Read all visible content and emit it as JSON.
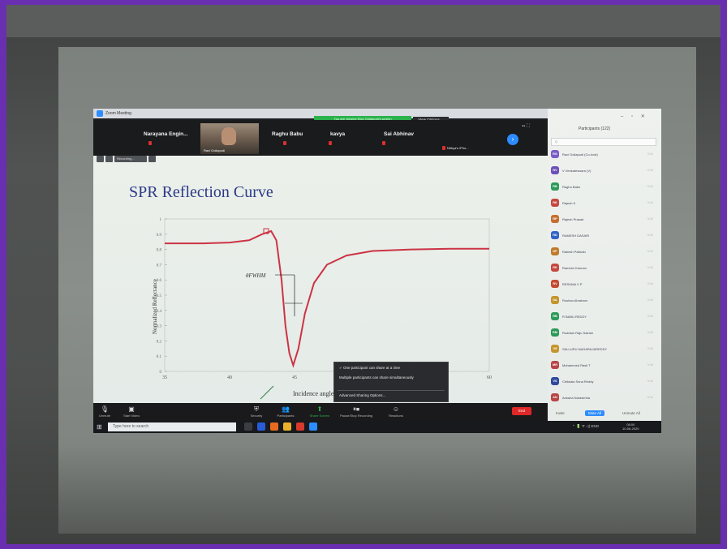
{
  "zoom": {
    "window_title": "Zoom Meeting",
    "share_banner": "You are viewing Ravi Gollapudi's screen",
    "view_options_label": "View Options ⌄"
  },
  "video_tiles": [
    {
      "name": "Narayana Engin...",
      "caption": ""
    },
    {
      "name": "",
      "caption": "Ravi Gollapudi"
    },
    {
      "name": "Raghu Babu",
      "caption": ""
    },
    {
      "name": "kavya",
      "caption": ""
    },
    {
      "name": "Sai Abhinav",
      "caption": ""
    },
    {
      "name": "",
      "caption": "Nithya's iPho..."
    }
  ],
  "slide": {
    "toolbar_label": "Recording...",
    "title": "SPR Reflection Curve"
  },
  "chart_data": {
    "type": "line",
    "title": "SPR Reflection Curve",
    "xlabel": "Incidence angle",
    "ylabel": "Normalized Reflectance",
    "xlim": [
      35,
      60
    ],
    "ylim": [
      0,
      1
    ],
    "x_ticks": [
      "35",
      "40",
      "45",
      "60"
    ],
    "y_ticks": [
      "0",
      "0.1",
      "0.2",
      "0.3",
      "0.4",
      "0.5",
      "0.6",
      "0.7",
      "0.8",
      "0.9",
      "1"
    ],
    "annotation": "θFWHM",
    "grid": false,
    "series": [
      {
        "color": "#cc3344",
        "x": [
          35,
          38,
          40,
          41.5,
          42.5,
          43.2,
          43.6,
          44,
          44.3,
          44.6,
          44.9,
          45.3,
          45.8,
          46.5,
          47.5,
          49,
          51,
          54,
          57,
          60
        ],
        "y": [
          0.84,
          0.84,
          0.845,
          0.86,
          0.9,
          0.92,
          0.86,
          0.6,
          0.3,
          0.12,
          0.04,
          0.15,
          0.38,
          0.58,
          0.7,
          0.76,
          0.79,
          0.8,
          0.805,
          0.805
        ]
      }
    ]
  },
  "share_menu": {
    "option_one": "✓  One participant can share at a time",
    "option_two": "Multiple participants can share simultaneously",
    "advanced": "Advanced Sharing Options..."
  },
  "toolbar": {
    "unmute": "Unmute",
    "start_video": "Start Video",
    "security": "Security",
    "participants": "Participants",
    "share_screen": "Share Screen",
    "recording": "Pause/Stop Recording",
    "reactions": "Reactions",
    "end": "End"
  },
  "participants_panel": {
    "title": "Participants (122)",
    "search_placeholder": "Q  ",
    "items": [
      {
        "initials": "RG",
        "name": "Ravi Gollapudi (Co-host)",
        "color": "#7a5cc7"
      },
      {
        "initials": "RV",
        "name": "V Venkateswara (V)",
        "color": "#6b4fb8"
      },
      {
        "initials": "RB",
        "name": "Raghu Babu",
        "color": "#2c9a58"
      },
      {
        "initials": "RK",
        "name": "Rajesh K",
        "color": "#c4483f"
      },
      {
        "initials": "RP",
        "name": "Rajesh Prasad",
        "color": "#c46e2f"
      },
      {
        "initials": "RD",
        "name": "RAMESH DASARI",
        "color": "#2f62c4"
      },
      {
        "initials": "DP",
        "name": "Rakesh Pallanki",
        "color": "#c07a2b"
      },
      {
        "initials": "RK",
        "name": "Ramesh Kannan",
        "color": "#c4483f"
      },
      {
        "initials": "RV",
        "name": "RESHMA V P",
        "color": "#c44a2f"
      },
      {
        "initials": "SA",
        "name": "Roshan Abraham",
        "color": "#c5952c"
      },
      {
        "initials": "RB",
        "name": "R BABU REDDY",
        "color": "#2c9a58"
      },
      {
        "initials": "RM",
        "name": "Ruddam Raju Sairam",
        "color": "#2c9a58"
      },
      {
        "initials": "VS",
        "name": "SALLURU NAGARAJAREDDY",
        "color": "#c5952c"
      },
      {
        "initials": "MR",
        "name": "Muhammed Rasil T",
        "color": "#b84545"
      },
      {
        "initials": "VS",
        "name": "Chikkala Sona Reddy",
        "color": "#2f4a9c"
      },
      {
        "initials": "AN",
        "name": "Ankana Narasimha",
        "color": "#b84545"
      }
    ],
    "footer": {
      "invite": "Invite",
      "mute_all": "Mute All",
      "unmute_all": "Unmute All"
    }
  },
  "taskbar": {
    "search_placeholder": "Type here to search",
    "tray": "⌃  🔋  ᯤ  ◁)  ENG",
    "time": "08:00",
    "date": "10-06-2020"
  }
}
